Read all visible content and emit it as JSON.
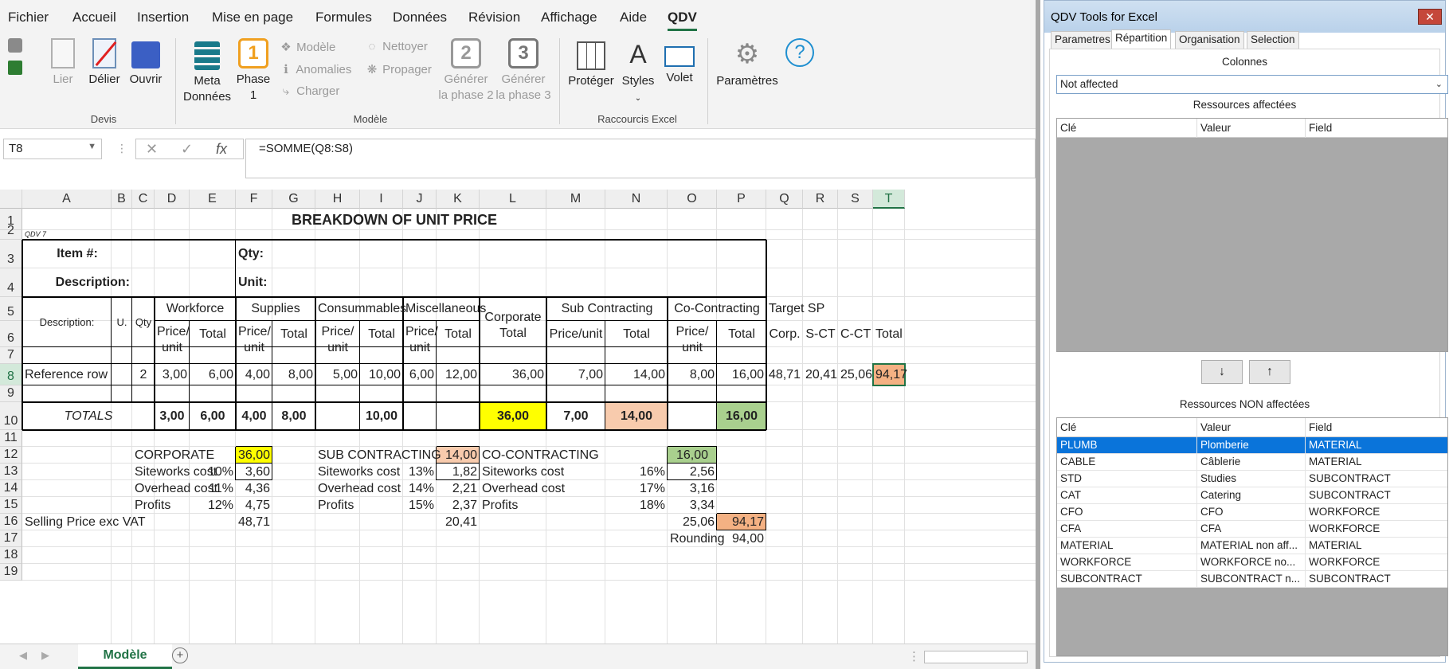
{
  "menu": [
    "Fichier",
    "Accueil",
    "Insertion",
    "Mise en page",
    "Formules",
    "Données",
    "Révision",
    "Affichage",
    "Aide",
    "QDV"
  ],
  "ribbon": {
    "lier": "Lier",
    "delier": "Délier",
    "ouvrir": "Ouvrir",
    "meta_l1": "Meta",
    "meta_l2": "Données",
    "phase_l1": "Phase",
    "phase_l2": "1",
    "phase_num": "1",
    "modele_s": "Modèle",
    "anomalies": "Anomalies",
    "charger": "Charger",
    "nettoyer": "Nettoyer",
    "propager": "Propager",
    "gen2_num": "2",
    "gen2_l1": "Générer",
    "gen2_l2": "la phase 2",
    "gen3_num": "3",
    "gen3_l1": "Générer",
    "gen3_l2": "la phase 3",
    "proteger": "Protéger",
    "styles": "Styles",
    "volet": "Volet",
    "parametres": "Paramètres",
    "group_devis": "Devis",
    "group_modele": "Modèle",
    "group_raccourcis": "Raccourcis Excel"
  },
  "formula_bar": {
    "name_box": "T8",
    "formula": "=SOMME(Q8:S8)"
  },
  "columns": [
    "A",
    "B",
    "C",
    "D",
    "E",
    "F",
    "G",
    "H",
    "I",
    "J",
    "K",
    "L",
    "M",
    "N",
    "O",
    "P",
    "Q",
    "R",
    "S",
    "T"
  ],
  "rows": [
    "1",
    "2",
    "3",
    "4",
    "5",
    "6",
    "7",
    "8",
    "9",
    "10",
    "11",
    "12",
    "13",
    "14",
    "15",
    "16",
    "17",
    "18",
    "19"
  ],
  "sheet": {
    "title": "BREAKDOWN OF UNIT PRICE",
    "qdv": "QDV 7",
    "item": "Item #:",
    "qty": "Qty:",
    "description": "Description:",
    "unit": "Unit:",
    "h_desc": "Description:",
    "h_u": "U.",
    "h_qty": "Qty",
    "h_workforce": "Workforce",
    "h_supplies": "Supplies",
    "h_consumables": "Consummables",
    "h_misc": "Miscellaneous",
    "h_corp1": "Corporate",
    "h_corp2": "Total",
    "h_sub": "Sub Contracting",
    "h_co": "Co-Contracting",
    "h_target": "Target SP",
    "pu1": "Price/",
    "pu2": "unit",
    "total": "Total",
    "price_unit": "Price/unit",
    "h_corp": "Corp.",
    "h_sct": "S-CT",
    "h_cct": "C-CT",
    "ref": [
      "Reference row",
      "2",
      "3,00",
      "6,00",
      "4,00",
      "8,00",
      "5,00",
      "10,00",
      "6,00",
      "12,00",
      "36,00",
      "7,00",
      "14,00",
      "8,00",
      "16,00",
      "48,71",
      "20,41",
      "25,06",
      "94,17"
    ],
    "totals": [
      "TOTALS",
      "3,00",
      "6,00",
      "4,00",
      "8,00",
      "10,00",
      "36,00",
      "7,00",
      "14,00",
      "16,00"
    ],
    "summary": {
      "corporate": "CORPORATE",
      "corp_val": "36,00",
      "siteworks": "Siteworks cost",
      "overhead": "Overhead cost",
      "profits": "Profits",
      "c_pct": [
        "10%",
        "11%",
        "12%"
      ],
      "c_vals": [
        "3,60",
        "4,36",
        "4,75"
      ],
      "selling": "Selling Price  exc VAT",
      "c_sp": "48,71",
      "subcontracting": "SUB CONTRACTING",
      "sub_val": "14,00",
      "s_pct": [
        "13%",
        "14%",
        "15%"
      ],
      "s_vals": [
        "1,82",
        "2,21",
        "2,37"
      ],
      "s_sp": "20,41",
      "cocontracting": "CO-CONTRACTING",
      "co_val": "16,00",
      "o_pct": [
        "16%",
        "17%",
        "18%"
      ],
      "o_vals": [
        "2,56",
        "3,16",
        "3,34"
      ],
      "o_sp": "25,06",
      "total_sp": "94,17",
      "rounding": "Rounding",
      "rounding_val": "94,00"
    }
  },
  "sheet_tab": "Modèle",
  "colors": {
    "yellow": "#ffff00",
    "peach": "#f8cbad",
    "green": "#a9d08e",
    "orange": "#f4b183",
    "excel_green": "#217346"
  },
  "pane": {
    "title": "QDV Tools for Excel",
    "tabs": [
      "Parametres",
      "Répartition",
      "Organisation",
      "Selection"
    ],
    "colonnes": "Colonnes",
    "combo": "Not affected",
    "affected_label": "Ressources affectées",
    "nonaffected_label": "Ressources NON affectées",
    "headers": [
      "Clé",
      "Valeur",
      "Field"
    ],
    "down": "↓",
    "up": "↑",
    "rows": [
      [
        "PLUMB",
        "Plomberie",
        "MATERIAL"
      ],
      [
        "CABLE",
        "Câblerie",
        "MATERIAL"
      ],
      [
        "STD",
        "Studies",
        "SUBCONTRACT"
      ],
      [
        "CAT",
        "Catering",
        "SUBCONTRACT"
      ],
      [
        "CFO",
        "CFO",
        "WORKFORCE"
      ],
      [
        "CFA",
        "CFA",
        "WORKFORCE"
      ],
      [
        "MATERIAL",
        "MATERIAL non aff...",
        "MATERIAL"
      ],
      [
        "WORKFORCE",
        "WORKFORCE no...",
        "WORKFORCE"
      ],
      [
        "SUBCONTRACT",
        "SUBCONTRACT n...",
        "SUBCONTRACT"
      ]
    ]
  }
}
